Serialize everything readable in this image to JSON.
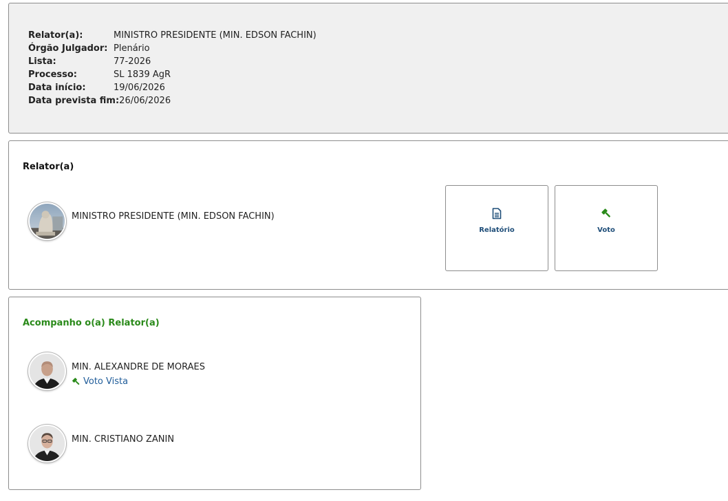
{
  "info": {
    "rows": [
      {
        "label": "Relator(a):",
        "value": "MINISTRO PRESIDENTE (MIN. EDSON FACHIN)"
      },
      {
        "label": "Órgão Julgador:",
        "value": "Plenário"
      },
      {
        "label": "Lista:",
        "value": "77-2026"
      },
      {
        "label": "Processo:",
        "value": "SL 1839 AgR"
      },
      {
        "label": "Data início:",
        "value": "19/06/2026"
      },
      {
        "label": "Data prevista fim:",
        "value": "26/06/2026"
      }
    ]
  },
  "relator": {
    "title": "Relator(a)",
    "member_name": "MINISTRO PRESIDENTE (MIN. EDSON FACHIN)",
    "actions": {
      "report_label": "Relatório",
      "report_icon": "document-icon",
      "vote_label": "Voto",
      "vote_icon": "gavel-icon"
    }
  },
  "accompany": {
    "title": "Acompanho o(a) Relator(a)",
    "members": [
      {
        "name": "MIN. ALEXANDRE DE MORAES",
        "link": "Voto Vista"
      },
      {
        "name": "MIN. CRISTIANO ZANIN"
      }
    ]
  },
  "colors": {
    "accent_blue": "#1f4e79",
    "link_blue": "#1f5c99",
    "green": "#2a8a1a",
    "panel_gray": "#f0f0f0"
  }
}
